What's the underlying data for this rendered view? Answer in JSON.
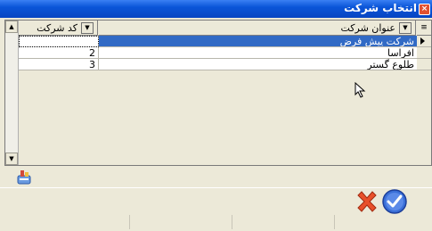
{
  "window": {
    "title": "انتخاب شرکت",
    "close_glyph": "×"
  },
  "grid": {
    "columns": [
      {
        "key": "code",
        "label": "کد شرکت"
      },
      {
        "key": "title",
        "label": "عنوان شرکت"
      }
    ],
    "header_indicator_glyph": "≡",
    "rows": [
      {
        "code": "",
        "title": "شرکت پیش فرض",
        "selected": true
      },
      {
        "code": "2",
        "title": "افراسا",
        "selected": false
      },
      {
        "code": "3",
        "title": "طلوع گستر",
        "selected": false
      }
    ],
    "scroll_up_glyph": "▲",
    "scroll_down_glyph": "▼",
    "dropdown_glyph": "▼"
  },
  "toolbar": {
    "icon": "report-icon"
  },
  "actions": {
    "cancel_icon": "cancel-x-icon",
    "ok_icon": "ok-check-icon"
  },
  "colors": {
    "title_bar": "#0a55d8",
    "selection": "#316ac5",
    "cancel": "#e8502a",
    "ok": "#3a6fd8"
  }
}
